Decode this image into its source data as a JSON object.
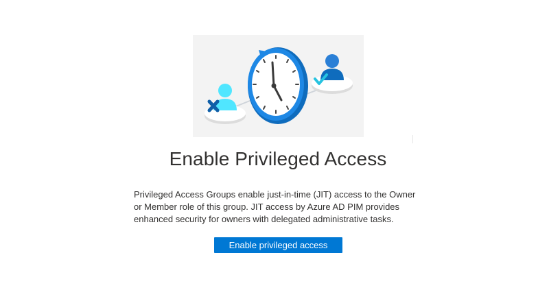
{
  "page": {
    "title": "Enable Privileged Access",
    "description_lines": [
      "Privileged Access Groups enable just-in-time (JIT) access to the Owner",
      "or Member role of this group. JIT access by Azure AD PIM provides",
      "enhanced security for owners with delegated administrative tasks."
    ],
    "button_label": "Enable privileged access"
  },
  "illustration": {
    "icons": [
      "user-denied-icon",
      "clock-icon",
      "user-approved-icon"
    ]
  },
  "colors": {
    "accent": "#0078d4",
    "background": "#ffffff",
    "hero_background": "#f3f3f3",
    "text": "#323130"
  }
}
